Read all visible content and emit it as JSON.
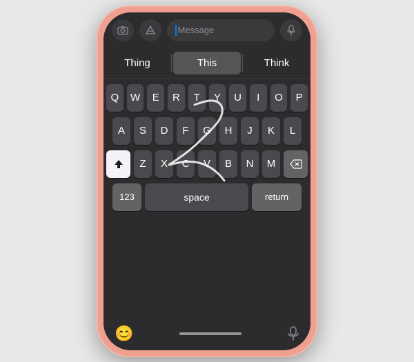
{
  "phone": {
    "top_bar": {
      "message_placeholder": "Message"
    },
    "predictive": {
      "items": [
        "Thing",
        "This",
        "Think"
      ],
      "active_index": 1
    },
    "keyboard": {
      "rows": [
        [
          "Q",
          "W",
          "E",
          "R",
          "T",
          "Y",
          "U",
          "I",
          "O",
          "P"
        ],
        [
          "A",
          "S",
          "D",
          "F",
          "G",
          "H",
          "J",
          "K",
          "L"
        ],
        [
          "Z",
          "X",
          "C",
          "V",
          "B",
          "N",
          "M"
        ]
      ],
      "bottom_row": {
        "num_label": "123",
        "space_label": "space",
        "return_label": "return"
      }
    },
    "bottom_bar": {
      "emoji_label": "😊",
      "mic_label": "🎤"
    },
    "home_indicator": true
  }
}
